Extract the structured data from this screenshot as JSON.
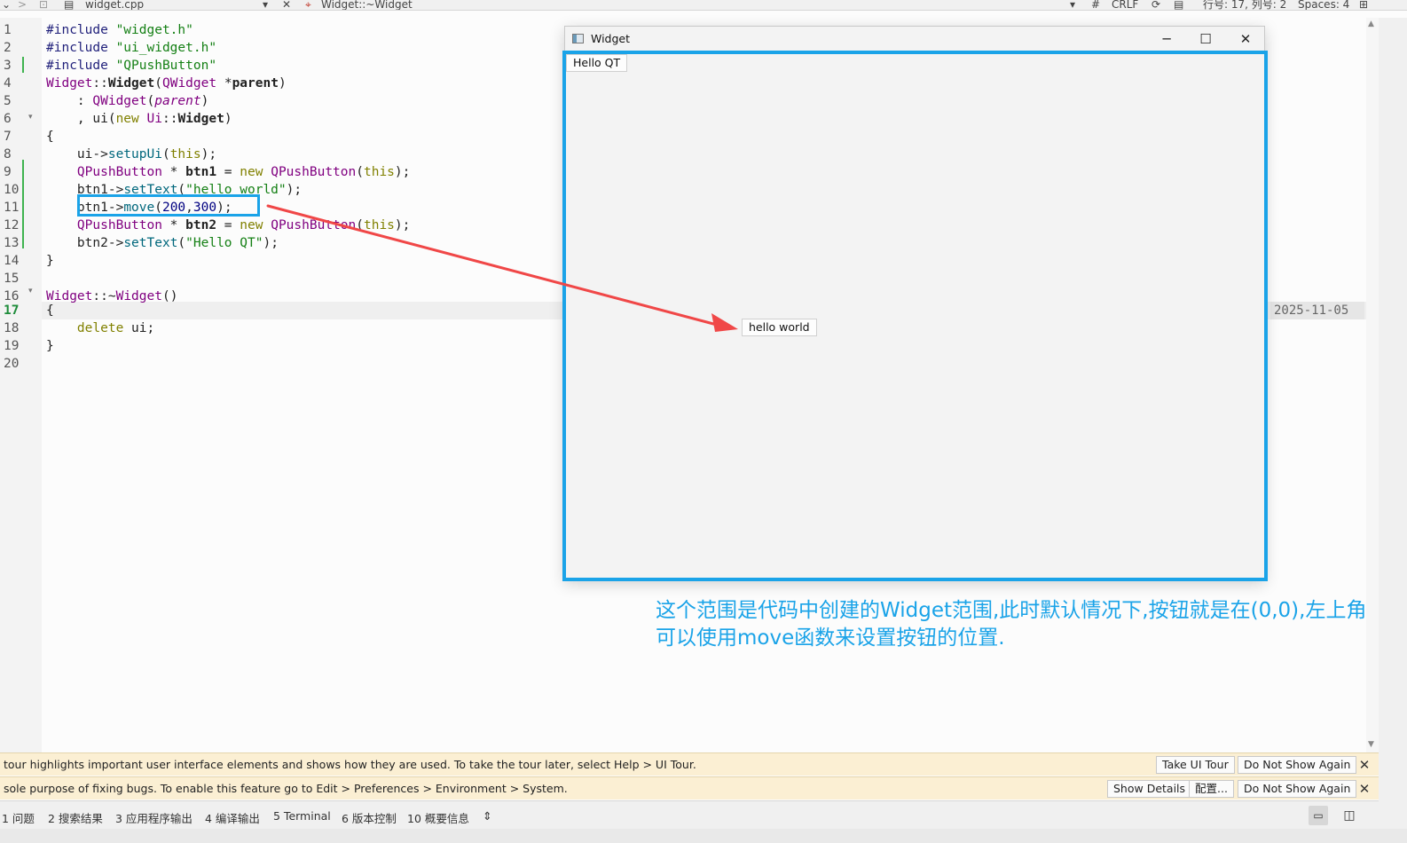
{
  "toolbar": {
    "file_name": "widget.cpp",
    "symbol": "Widget::~Widget",
    "hash": "#",
    "line_ending": "CRLF",
    "position": "行号: 17, 列号: 2",
    "indent": "Spaces: 4"
  },
  "editor": {
    "current_line": 17,
    "annotation_date": "2025-11-05",
    "lines": [
      "#include \"widget.h\"",
      "#include \"ui_widget.h\"",
      "#include \"QPushButton\"",
      "Widget::Widget(QWidget *parent)",
      "    : QWidget(parent)",
      "    , ui(new Ui::Widget)",
      "{",
      "    ui->setupUi(this);",
      "    QPushButton * btn1 = new QPushButton(this);",
      "    btn1->setText(\"hello world\");",
      "    btn1->move(200,300);",
      "    QPushButton * btn2 = new QPushButton(this);",
      "    btn2->setText(\"Hello QT\");",
      "}",
      "",
      "Widget::~Widget()",
      "{",
      "    delete ui;",
      "}",
      ""
    ]
  },
  "widget_window": {
    "title": "Widget",
    "minimize_glyph": "─",
    "maximize_glyph": "☐",
    "close_glyph": "✕",
    "btn2_label": "Hello QT",
    "btn1_label": "hello world"
  },
  "annotation": {
    "line1": "这个范围是代码中创建的Widget范围,此时默认情况下,按钮就是在(0,0),左上角",
    "line2": "可以使用move函数来设置按钮的位置.",
    "color": "#1aa3e8"
  },
  "infobars": [
    {
      "message": "tour highlights important user interface elements and shows how they are used. To take the tour later, select Help > UI Tour.",
      "buttons": [
        "Take UI Tour",
        "Do Not Show Again"
      ]
    },
    {
      "message": "sole purpose of fixing bugs. To enable this feature go to Edit > Preferences > Environment > System.",
      "buttons": [
        "Show Details",
        "配置...",
        "Do Not Show Again"
      ]
    }
  ],
  "output_panes": [
    "1 问题",
    "2 搜索结果",
    "3 应用程序输出",
    "4 编译输出",
    "5 Terminal",
    "6 版本控制",
    "10 概要信息"
  ],
  "output_panes_toggle": "⇕",
  "close_glyph": "✕"
}
